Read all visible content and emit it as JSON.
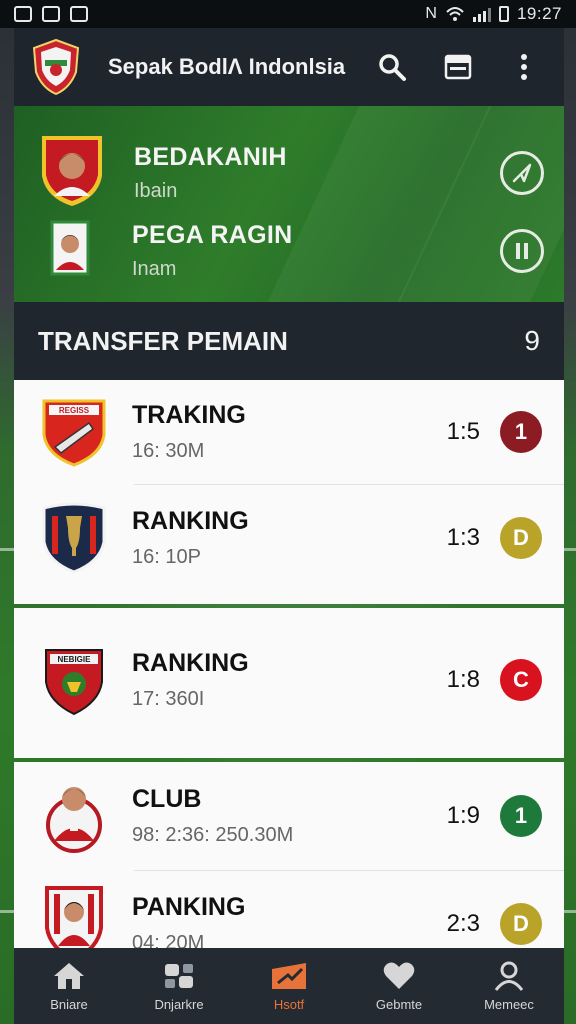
{
  "status_bar": {
    "time": "19:27"
  },
  "app_bar": {
    "title": "Sepak BodlΛ Indonlsia",
    "icons": [
      "search-icon",
      "calendar-icon",
      "more-vert-icon"
    ]
  },
  "hero": {
    "players": [
      {
        "name": "BEDAKANIH",
        "sub": "Ibain",
        "action_icon": "send-icon"
      },
      {
        "name": "PEGA RAGIN",
        "sub": "Inam",
        "action_icon": "pause-icon"
      }
    ]
  },
  "section": {
    "title": "TRANSFER PEMAIN",
    "count": "9"
  },
  "transfers": [
    {
      "title": "TRAKING",
      "sub": "16: 30M",
      "score": "1:5",
      "badge": "1",
      "badge_color": "#8c1c24",
      "crest_label": "REGISS"
    },
    {
      "title": "RANKING",
      "sub": "16: 10P",
      "score": "1:3",
      "badge": "D",
      "badge_color": "#b9a329"
    },
    {
      "title": "RANKING",
      "sub": "17: 360I",
      "score": "1:8",
      "badge": "C",
      "badge_color": "#d8121f",
      "crest_label": "NEBIGIE"
    },
    {
      "title": "CLUB",
      "sub": "98: 2:36: 250.30M",
      "score": "1:9",
      "badge": "1",
      "badge_color": "#1e7a3a"
    },
    {
      "title": "PANKING",
      "sub": "04: 20M",
      "score": "2:3",
      "badge": "D",
      "badge_color": "#b9a329"
    }
  ],
  "bottom_nav": [
    {
      "label": "Bniare",
      "icon": "home-icon"
    },
    {
      "label": "Dnjarkre",
      "icon": "transfer-icon"
    },
    {
      "label": "Hsotf",
      "icon": "trend-icon",
      "active": true
    },
    {
      "label": "Gebmte",
      "icon": "heart-icon"
    },
    {
      "label": "Memeec",
      "icon": "profile-icon"
    }
  ],
  "colors": {
    "accent": "#e8733a",
    "hero_green": "#2f7d2b",
    "bar": "#1f262e"
  }
}
